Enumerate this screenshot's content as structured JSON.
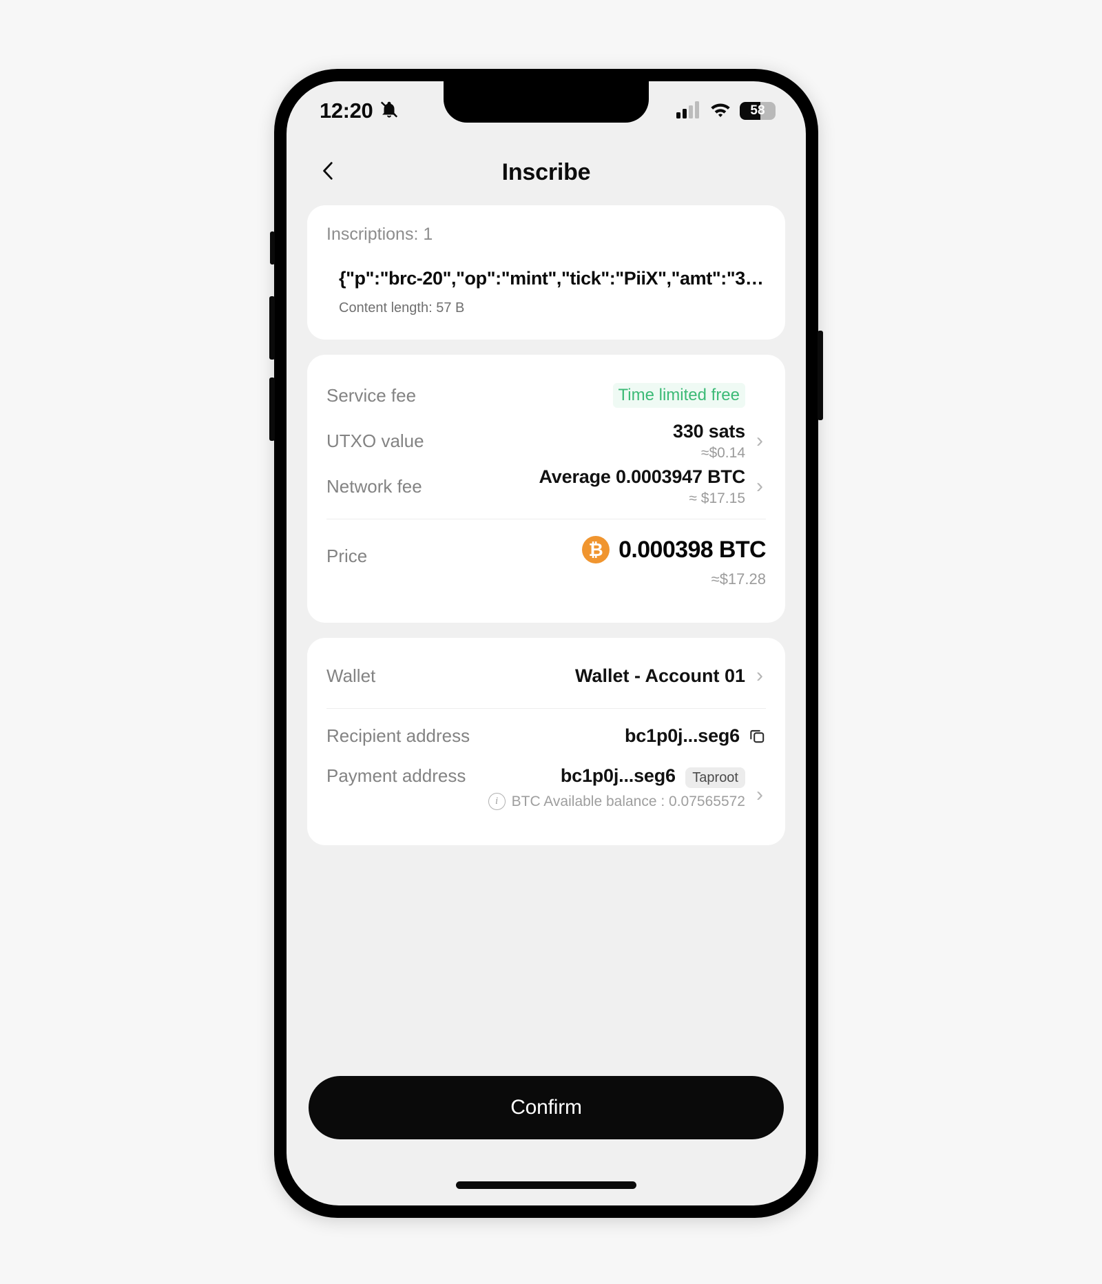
{
  "status_bar": {
    "time": "12:20",
    "silent_icon": "bell-slash-icon",
    "signal_icon": "cellular-signal-icon",
    "wifi_icon": "wifi-icon",
    "battery_percent": "58"
  },
  "header": {
    "back_icon": "chevron-left-icon",
    "title": "Inscribe"
  },
  "inscription_card": {
    "count_label": "Inscriptions: 1",
    "content": "{\"p\":\"brc-20\",\"op\":\"mint\",\"tick\":\"PiiX\",\"amt\":\"3…",
    "content_length": "Content length: 57 B"
  },
  "fee_card": {
    "service_fee": {
      "label": "Service fee",
      "badge": "Time limited free",
      "badge_color": "#3cba76",
      "badge_bg": "#effaf4"
    },
    "utxo_value": {
      "label": "UTXO value",
      "value": "330 sats",
      "fiat": "≈$0.14",
      "chevron": "chevron-right-icon"
    },
    "network_fee": {
      "label": "Network fee",
      "value": "Average 0.0003947 BTC",
      "fiat": "≈ $17.15",
      "chevron": "chevron-right-icon"
    },
    "price": {
      "label": "Price",
      "coin_icon": "bitcoin-icon",
      "coin_color": "#f0952f",
      "value": "0.000398 BTC",
      "fiat": "≈$17.28"
    }
  },
  "wallet_card": {
    "wallet": {
      "label": "Wallet",
      "value": "Wallet - Account 01",
      "chevron": "chevron-right-icon"
    },
    "recipient_address": {
      "label": "Recipient address",
      "value": "bc1p0j...seg6",
      "copy_icon": "copy-icon"
    },
    "payment_address": {
      "label": "Payment address",
      "value": "bc1p0j...seg6",
      "tag": "Taproot",
      "info_icon": "info-icon",
      "balance": "BTC Available balance : 0.07565572",
      "chevron": "chevron-right-icon"
    }
  },
  "footer": {
    "confirm_label": "Confirm"
  }
}
